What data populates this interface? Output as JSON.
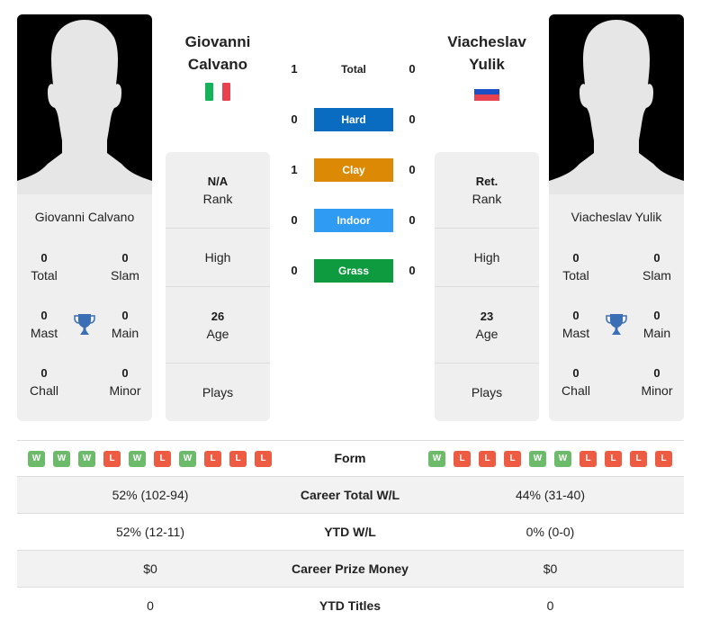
{
  "player1": {
    "name_line1": "Giovanni",
    "name_line2": "Calvano",
    "full_name": "Giovanni Calvano",
    "flag": "italy-flag",
    "flag_colors": [
      "#14b35a",
      "#ffffff",
      "#e8414f"
    ],
    "titles": {
      "total": {
        "value": "0",
        "label": "Total"
      },
      "slam": {
        "value": "0",
        "label": "Slam"
      },
      "mast": {
        "value": "0",
        "label": "Mast"
      },
      "main": {
        "value": "0",
        "label": "Main"
      },
      "chall": {
        "value": "0",
        "label": "Chall"
      },
      "minor": {
        "value": "0",
        "label": "Minor"
      }
    },
    "info": {
      "rank": {
        "value": "N/A",
        "label": "Rank"
      },
      "high": {
        "value": "",
        "label": "High"
      },
      "age": {
        "value": "26",
        "label": "Age"
      },
      "plays": {
        "value": "",
        "label": "Plays"
      }
    },
    "form": [
      "W",
      "W",
      "W",
      "L",
      "W",
      "L",
      "W",
      "L",
      "L",
      "L"
    ]
  },
  "player2": {
    "name_line1": "Viacheslav",
    "name_line2": "Yulik",
    "full_name": "Viacheslav Yulik",
    "flag": "russia-flag",
    "flag_colors": [
      "#ffffff",
      "#1c4fc4",
      "#e8414f"
    ],
    "titles": {
      "total": {
        "value": "0",
        "label": "Total"
      },
      "slam": {
        "value": "0",
        "label": "Slam"
      },
      "mast": {
        "value": "0",
        "label": "Mast"
      },
      "main": {
        "value": "0",
        "label": "Main"
      },
      "chall": {
        "value": "0",
        "label": "Chall"
      },
      "minor": {
        "value": "0",
        "label": "Minor"
      }
    },
    "info": {
      "rank": {
        "value": "Ret.",
        "label": "Rank"
      },
      "high": {
        "value": "",
        "label": "High"
      },
      "age": {
        "value": "23",
        "label": "Age"
      },
      "plays": {
        "value": "",
        "label": "Plays"
      }
    },
    "form": [
      "W",
      "L",
      "L",
      "L",
      "W",
      "W",
      "L",
      "L",
      "L",
      "L"
    ]
  },
  "head_to_head": [
    {
      "label": "Total",
      "p1": "1",
      "p2": "0",
      "color": ""
    },
    {
      "label": "Hard",
      "p1": "0",
      "p2": "0",
      "color": "#0a6cc0"
    },
    {
      "label": "Clay",
      "p1": "1",
      "p2": "0",
      "color": "#dc8a06"
    },
    {
      "label": "Indoor",
      "p1": "0",
      "p2": "0",
      "color": "#2f9bf2"
    },
    {
      "label": "Grass",
      "p1": "0",
      "p2": "0",
      "color": "#0e9a3e"
    }
  ],
  "form_label": "Form",
  "stats": [
    {
      "label": "Career Total W/L",
      "p1": "52% (102-94)",
      "p2": "44% (31-40)"
    },
    {
      "label": "YTD W/L",
      "p1": "52% (12-11)",
      "p2": "0% (0-0)"
    },
    {
      "label": "Career Prize Money",
      "p1": "$0",
      "p2": "$0"
    },
    {
      "label": "YTD Titles",
      "p1": "0",
      "p2": "0"
    }
  ],
  "colors": {
    "trophy": "#3a6fb5",
    "win": "#6cbb6a",
    "loss": "#ec5b42"
  }
}
